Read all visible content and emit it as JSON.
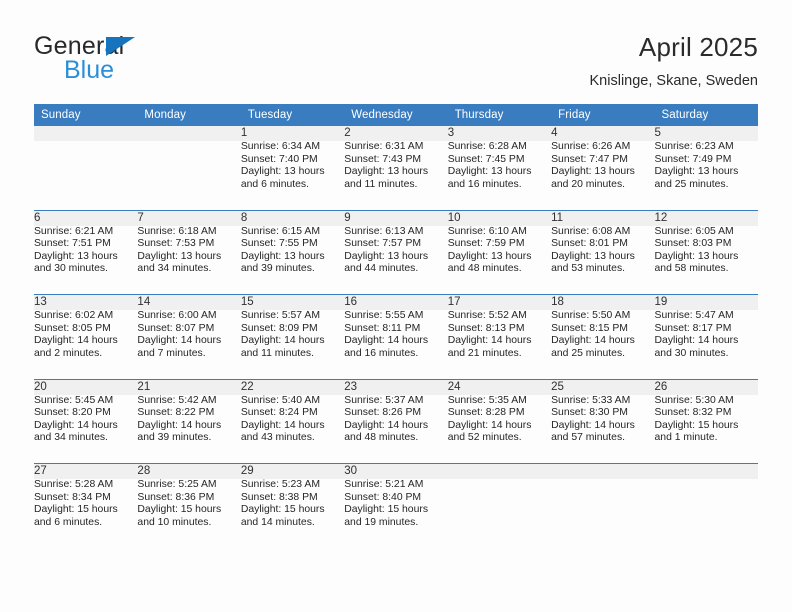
{
  "brand": {
    "line1": "General",
    "line2": "Blue",
    "logo_icon": "blue-triangle-logo"
  },
  "header": {
    "title": "April 2025",
    "subtitle": "Knislinge, Skane, Sweden"
  },
  "colors": {
    "header_blue": "#3a7cc0",
    "brand_dark": "#27292b",
    "brand_blue": "#2a8fd8",
    "daynum_band": "#f0f0f0",
    "page_bg": "#fdfdfd"
  },
  "weekday_headers": [
    "Sunday",
    "Monday",
    "Tuesday",
    "Wednesday",
    "Thursday",
    "Friday",
    "Saturday"
  ],
  "weeks": [
    [
      {
        "day": "",
        "lines": []
      },
      {
        "day": "",
        "lines": []
      },
      {
        "day": "1",
        "lines": [
          "Sunrise: 6:34 AM",
          "Sunset: 7:40 PM",
          "Daylight: 13 hours",
          "and 6 minutes."
        ]
      },
      {
        "day": "2",
        "lines": [
          "Sunrise: 6:31 AM",
          "Sunset: 7:43 PM",
          "Daylight: 13 hours",
          "and 11 minutes."
        ]
      },
      {
        "day": "3",
        "lines": [
          "Sunrise: 6:28 AM",
          "Sunset: 7:45 PM",
          "Daylight: 13 hours",
          "and 16 minutes."
        ]
      },
      {
        "day": "4",
        "lines": [
          "Sunrise: 6:26 AM",
          "Sunset: 7:47 PM",
          "Daylight: 13 hours",
          "and 20 minutes."
        ]
      },
      {
        "day": "5",
        "lines": [
          "Sunrise: 6:23 AM",
          "Sunset: 7:49 PM",
          "Daylight: 13 hours",
          "and 25 minutes."
        ]
      }
    ],
    [
      {
        "day": "6",
        "lines": [
          "Sunrise: 6:21 AM",
          "Sunset: 7:51 PM",
          "Daylight: 13 hours",
          "and 30 minutes."
        ]
      },
      {
        "day": "7",
        "lines": [
          "Sunrise: 6:18 AM",
          "Sunset: 7:53 PM",
          "Daylight: 13 hours",
          "and 34 minutes."
        ]
      },
      {
        "day": "8",
        "lines": [
          "Sunrise: 6:15 AM",
          "Sunset: 7:55 PM",
          "Daylight: 13 hours",
          "and 39 minutes."
        ]
      },
      {
        "day": "9",
        "lines": [
          "Sunrise: 6:13 AM",
          "Sunset: 7:57 PM",
          "Daylight: 13 hours",
          "and 44 minutes."
        ]
      },
      {
        "day": "10",
        "lines": [
          "Sunrise: 6:10 AM",
          "Sunset: 7:59 PM",
          "Daylight: 13 hours",
          "and 48 minutes."
        ]
      },
      {
        "day": "11",
        "lines": [
          "Sunrise: 6:08 AM",
          "Sunset: 8:01 PM",
          "Daylight: 13 hours",
          "and 53 minutes."
        ]
      },
      {
        "day": "12",
        "lines": [
          "Sunrise: 6:05 AM",
          "Sunset: 8:03 PM",
          "Daylight: 13 hours",
          "and 58 minutes."
        ]
      }
    ],
    [
      {
        "day": "13",
        "lines": [
          "Sunrise: 6:02 AM",
          "Sunset: 8:05 PM",
          "Daylight: 14 hours",
          "and 2 minutes."
        ]
      },
      {
        "day": "14",
        "lines": [
          "Sunrise: 6:00 AM",
          "Sunset: 8:07 PM",
          "Daylight: 14 hours",
          "and 7 minutes."
        ]
      },
      {
        "day": "15",
        "lines": [
          "Sunrise: 5:57 AM",
          "Sunset: 8:09 PM",
          "Daylight: 14 hours",
          "and 11 minutes."
        ]
      },
      {
        "day": "16",
        "lines": [
          "Sunrise: 5:55 AM",
          "Sunset: 8:11 PM",
          "Daylight: 14 hours",
          "and 16 minutes."
        ]
      },
      {
        "day": "17",
        "lines": [
          "Sunrise: 5:52 AM",
          "Sunset: 8:13 PM",
          "Daylight: 14 hours",
          "and 21 minutes."
        ]
      },
      {
        "day": "18",
        "lines": [
          "Sunrise: 5:50 AM",
          "Sunset: 8:15 PM",
          "Daylight: 14 hours",
          "and 25 minutes."
        ]
      },
      {
        "day": "19",
        "lines": [
          "Sunrise: 5:47 AM",
          "Sunset: 8:17 PM",
          "Daylight: 14 hours",
          "and 30 minutes."
        ]
      }
    ],
    [
      {
        "day": "20",
        "lines": [
          "Sunrise: 5:45 AM",
          "Sunset: 8:20 PM",
          "Daylight: 14 hours",
          "and 34 minutes."
        ]
      },
      {
        "day": "21",
        "lines": [
          "Sunrise: 5:42 AM",
          "Sunset: 8:22 PM",
          "Daylight: 14 hours",
          "and 39 minutes."
        ]
      },
      {
        "day": "22",
        "lines": [
          "Sunrise: 5:40 AM",
          "Sunset: 8:24 PM",
          "Daylight: 14 hours",
          "and 43 minutes."
        ]
      },
      {
        "day": "23",
        "lines": [
          "Sunrise: 5:37 AM",
          "Sunset: 8:26 PM",
          "Daylight: 14 hours",
          "and 48 minutes."
        ]
      },
      {
        "day": "24",
        "lines": [
          "Sunrise: 5:35 AM",
          "Sunset: 8:28 PM",
          "Daylight: 14 hours",
          "and 52 minutes."
        ]
      },
      {
        "day": "25",
        "lines": [
          "Sunrise: 5:33 AM",
          "Sunset: 8:30 PM",
          "Daylight: 14 hours",
          "and 57 minutes."
        ]
      },
      {
        "day": "26",
        "lines": [
          "Sunrise: 5:30 AM",
          "Sunset: 8:32 PM",
          "Daylight: 15 hours",
          "and 1 minute."
        ]
      }
    ],
    [
      {
        "day": "27",
        "lines": [
          "Sunrise: 5:28 AM",
          "Sunset: 8:34 PM",
          "Daylight: 15 hours",
          "and 6 minutes."
        ]
      },
      {
        "day": "28",
        "lines": [
          "Sunrise: 5:25 AM",
          "Sunset: 8:36 PM",
          "Daylight: 15 hours",
          "and 10 minutes."
        ]
      },
      {
        "day": "29",
        "lines": [
          "Sunrise: 5:23 AM",
          "Sunset: 8:38 PM",
          "Daylight: 15 hours",
          "and 14 minutes."
        ]
      },
      {
        "day": "30",
        "lines": [
          "Sunrise: 5:21 AM",
          "Sunset: 8:40 PM",
          "Daylight: 15 hours",
          "and 19 minutes."
        ]
      },
      {
        "day": "",
        "lines": []
      },
      {
        "day": "",
        "lines": []
      },
      {
        "day": "",
        "lines": []
      }
    ]
  ]
}
